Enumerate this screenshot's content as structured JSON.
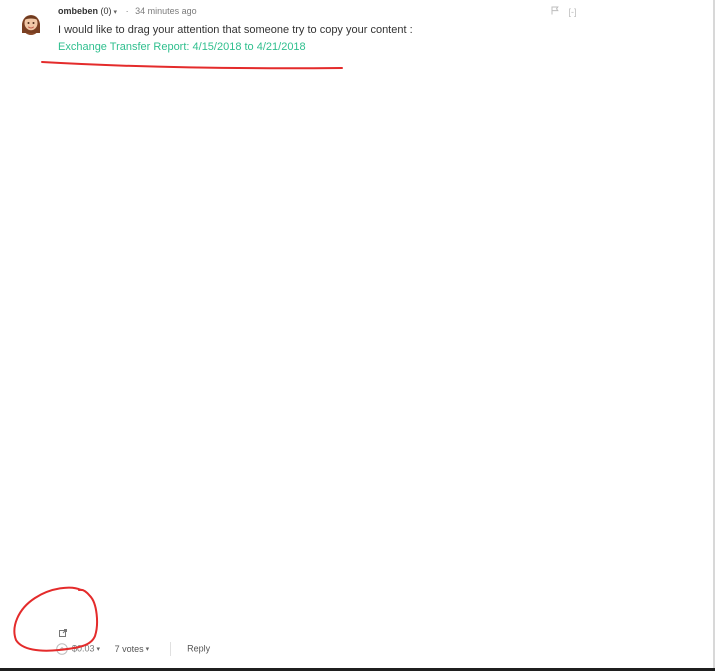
{
  "comment": {
    "author": "ombeben",
    "reputation": "(0)",
    "timestamp": "34 minutes ago",
    "text": "I would like to drag your attention that someone try to copy your content :",
    "link_text": "Exchange Transfer Report: 4/15/2018 to 4/21/2018"
  },
  "icons": {
    "avatar": "avatar-image",
    "flag": "flag-icon",
    "collapse": "collapse-icon",
    "share": "share-icon",
    "upvote": "upvote-icon",
    "dropdown": "chevron-down-icon"
  },
  "top_actions": {
    "collapse_label": "[-]"
  },
  "footer": {
    "payout": "$0.03",
    "votes": "7 votes",
    "reply": "Reply"
  },
  "colors": {
    "link": "#2fbf8e",
    "annotation": "#e42b2b"
  }
}
